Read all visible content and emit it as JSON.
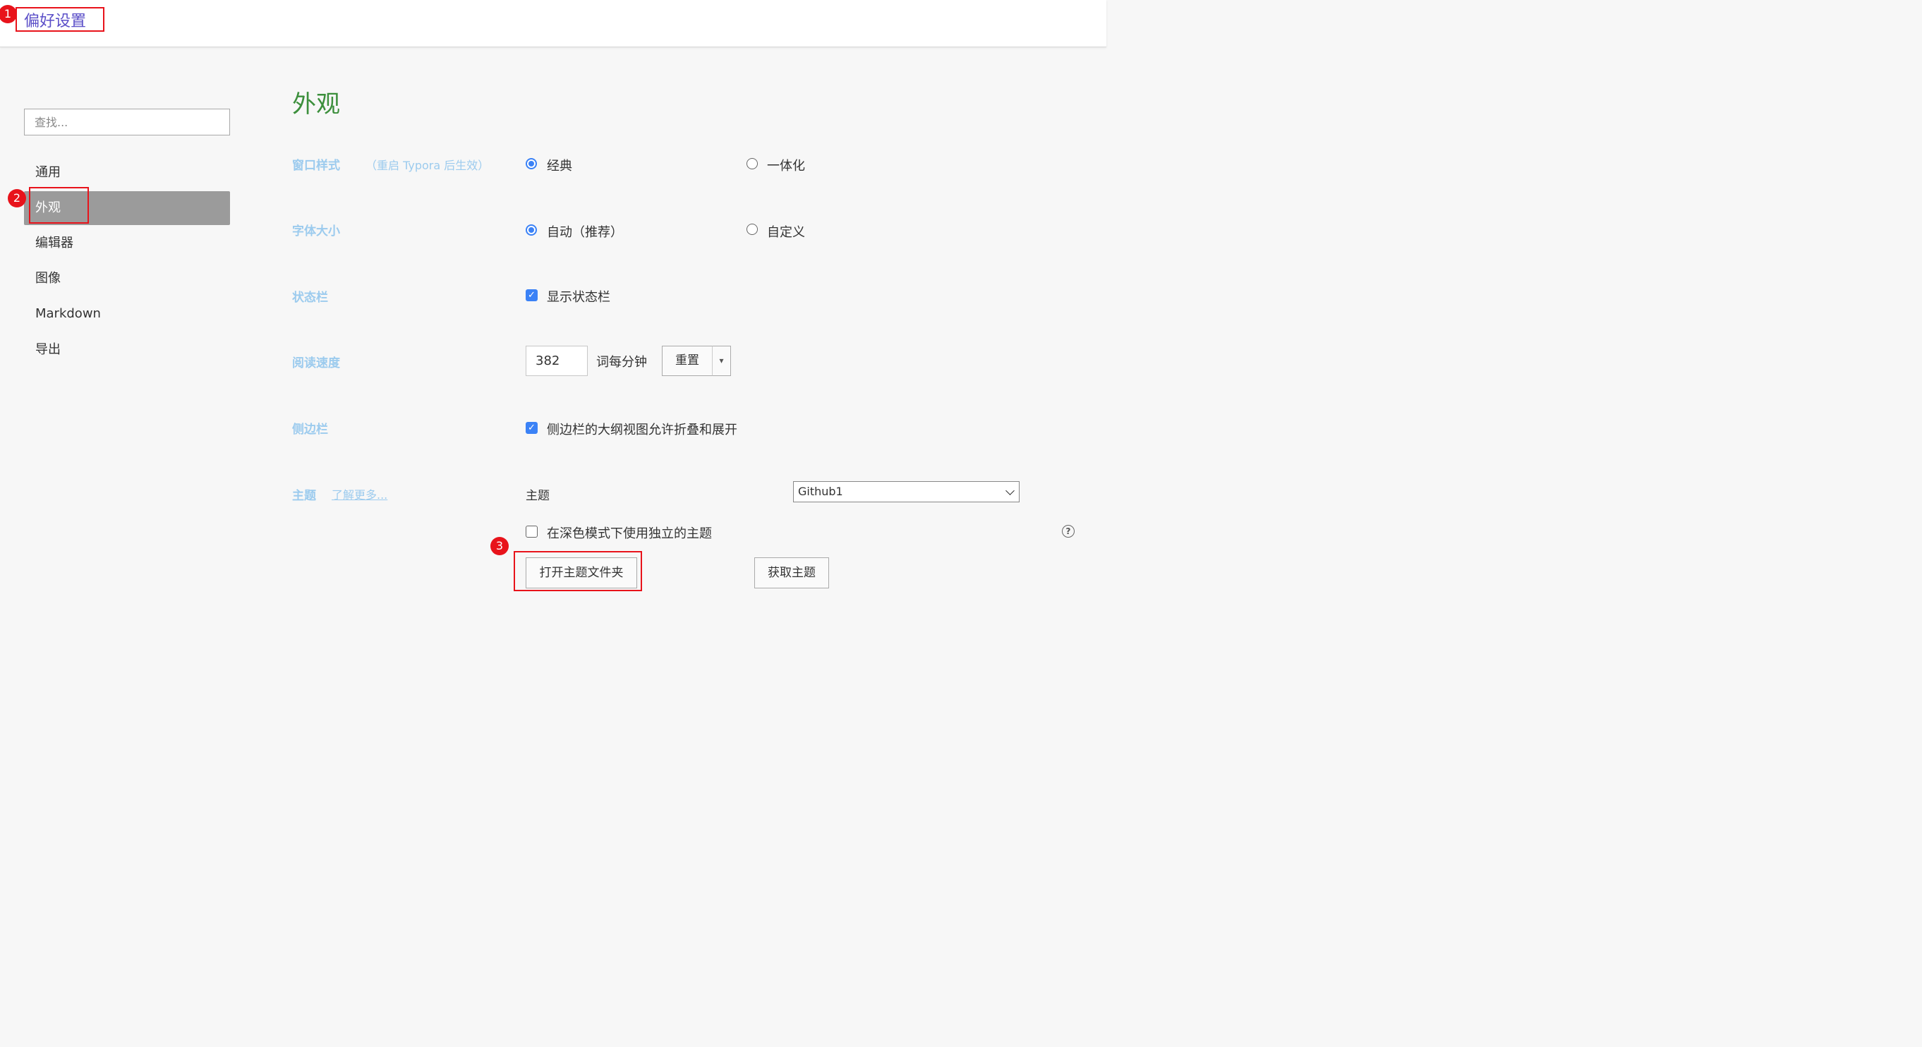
{
  "window": {
    "title": "偏好设置"
  },
  "annotations": [
    "1",
    "2",
    "3"
  ],
  "sidebar": {
    "search_placeholder": "查找...",
    "items": [
      {
        "label": "通用"
      },
      {
        "label": "外观"
      },
      {
        "label": "编辑器"
      },
      {
        "label": "图像"
      },
      {
        "label": "Markdown"
      },
      {
        "label": "导出"
      }
    ],
    "active": "外观"
  },
  "main": {
    "title": "外观",
    "window_style": {
      "label": "窗口样式",
      "hint": "（重启 Typora 后生效）",
      "options": [
        "经典",
        "一体化"
      ],
      "selected": "经典"
    },
    "font_size": {
      "label": "字体大小",
      "options": [
        "自动（推荐）",
        "自定义"
      ],
      "selected": "自动（推荐）"
    },
    "status_bar": {
      "label": "状态栏",
      "checkbox_label": "显示状态栏",
      "checked": true
    },
    "reading_speed": {
      "label": "阅读速度",
      "value": "382",
      "unit": "词每分钟",
      "reset_label": "重置",
      "dropdown_arrow": "▾"
    },
    "sidebar_setting": {
      "label": "侧边栏",
      "checkbox_label": "侧边栏的大纲视图允许折叠和展开",
      "checked": true
    },
    "theme": {
      "label": "主题",
      "learn_more": "了解更多...",
      "select_label": "主题",
      "selected_theme": "Github1",
      "dark_mode_label": "在深色模式下使用独立的主题",
      "dark_mode_checked": false,
      "help_icon": "?",
      "open_folder_label": "打开主题文件夹",
      "get_theme_label": "获取主题"
    }
  },
  "colors": {
    "accent": "#3b82f6",
    "title_green": "#3c8f3c",
    "label_blue": "#9ccbee",
    "annotation_red": "#e8131b",
    "window_title": "#5b4fc8"
  }
}
